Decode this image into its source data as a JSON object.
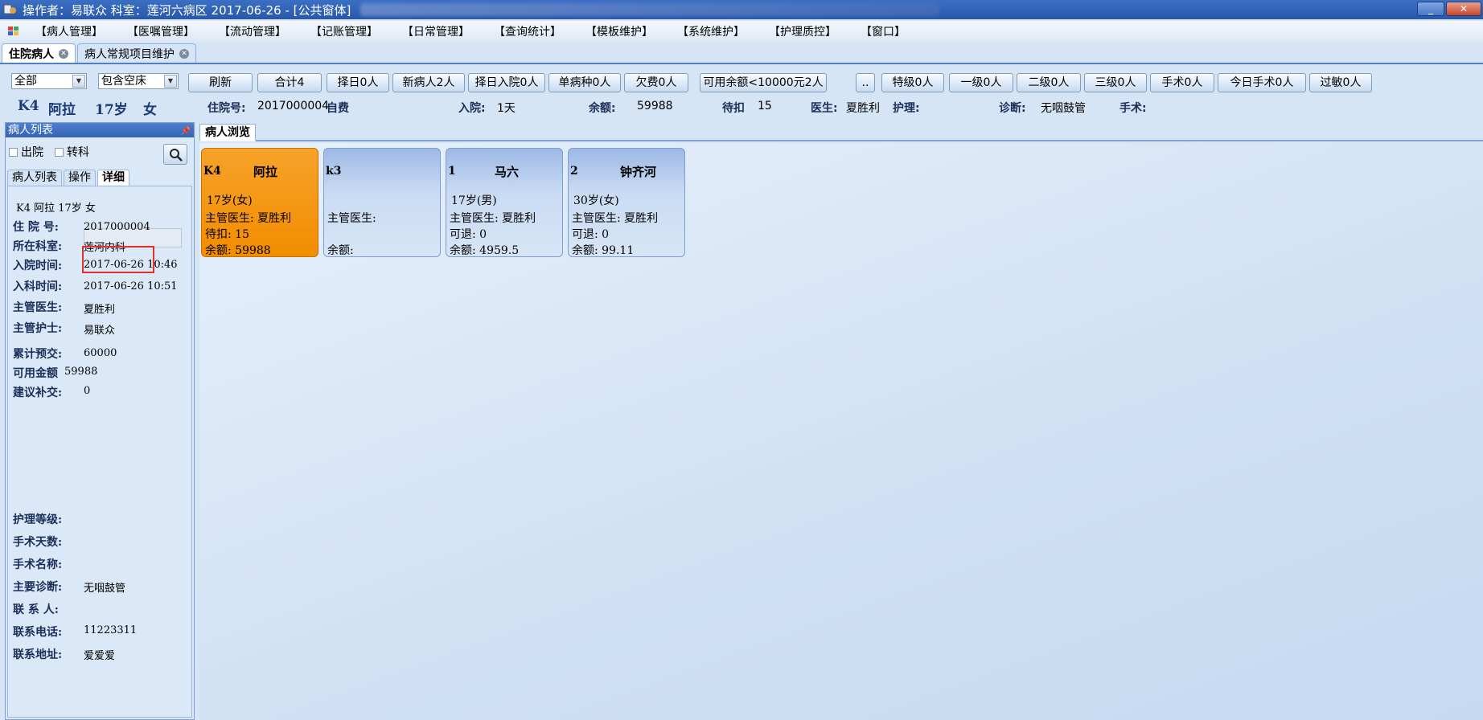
{
  "titlebar": {
    "text": "操作者：易联众  科室：莲河六病区  2017-06-26 - [公共窗体]",
    "minimize": "_",
    "close": "✕"
  },
  "menu": [
    "【病人管理】",
    "【医嘱管理】",
    "【流动管理】",
    "【记账管理】",
    "【日常管理】",
    "【查询统计】",
    "【模板维护】",
    "【系统维护】",
    "【护理质控】",
    "【窗口】"
  ],
  "doc_tabs": [
    {
      "label": "住院病人",
      "active": true
    },
    {
      "label": "病人常规项目维护",
      "active": false
    }
  ],
  "toolbar": {
    "filter1": "全部",
    "filter2": "包含空床",
    "buttons": [
      "刷新",
      "合计4",
      "择日0人",
      "新病人2人",
      "择日入院0人",
      "单病种0人",
      "欠费0人",
      "可用余额<10000元2人",
      "..",
      "特级0人",
      "一级0人",
      "二级0人",
      "三级0人",
      "手术0人",
      "今日手术0人",
      "过敏0人"
    ]
  },
  "summary": {
    "bed": "K4",
    "name": "阿拉",
    "age": "17岁",
    "sex": "女",
    "hosp_no_label": "住院号:",
    "hosp_no": "2017000004",
    "pay_type": "自费",
    "admit_label": "入院:",
    "admit_days": "1天",
    "balance_label": "余额:",
    "balance": "59988",
    "pending_label": "待扣",
    "pending": "15",
    "doctor_label": "医生:",
    "doctor": "夏胜利",
    "nurse_label": "护理:",
    "diag_label": "诊断:",
    "diag": "无咽鼓管",
    "surgery_label": "手术:"
  },
  "left_panel": {
    "title": "病人列表",
    "check_discharge": "出院",
    "check_transfer": "转科",
    "tabs": [
      "病人列表",
      "操作",
      "详细"
    ],
    "header_line": "K4  阿拉  17岁  女",
    "fields": [
      {
        "label": "住 院 号:",
        "value": "2017000004"
      },
      {
        "label": "所在科室:",
        "value": "莲河内科"
      },
      {
        "label": "入院时间:",
        "value": "2017-06-26 10:46"
      },
      {
        "label": "入科时间:",
        "value": "2017-06-26 10:51"
      },
      {
        "label": "主管医生:",
        "value": "夏胜利"
      },
      {
        "label": "主管护士:",
        "value": "易联众"
      },
      {
        "label": "累计预交:",
        "value": "60000"
      },
      {
        "label": "可用金额",
        "value": "59988"
      },
      {
        "label": "建议补交:",
        "value": "0"
      },
      {
        "label": "护理等级:",
        "value": ""
      },
      {
        "label": "手术天数:",
        "value": ""
      },
      {
        "label": "手术名称:",
        "value": ""
      },
      {
        "label": "主要诊断:",
        "value": "无咽鼓管"
      },
      {
        "label": "联  系  人:",
        "value": ""
      },
      {
        "label": "联系电话:",
        "value": "11223311"
      },
      {
        "label": "联系地址:",
        "value": "爱爱爱"
      }
    ]
  },
  "browse": {
    "tab": "病人浏览",
    "cards": [
      {
        "bed": "K4",
        "name": "阿拉",
        "agesex": "17岁(女)",
        "doctor_line": "主管医生: 夏胜利",
        "line3": "待扣: 15",
        "line4": "余额: 59988",
        "active": true
      },
      {
        "bed": "k3",
        "name": "",
        "agesex": "",
        "doctor_line": "主管医生:",
        "line3": "",
        "line4": "余额:",
        "active": false
      },
      {
        "bed": "1",
        "name": "马六",
        "agesex": "17岁(男)",
        "doctor_line": "主管医生: 夏胜利",
        "line3": "可退: 0",
        "line4": "余额: 4959.5",
        "active": false
      },
      {
        "bed": "2",
        "name": "钟齐河",
        "agesex": "30岁(女)",
        "doctor_line": "主管医生: 夏胜利",
        "line3": "可退: 0",
        "line4": "余额: 99.11",
        "active": false
      }
    ]
  },
  "colors": {
    "title_bar": "#2a58a8",
    "active_card": "#f28d00",
    "highlight_box": "#e0302a"
  }
}
